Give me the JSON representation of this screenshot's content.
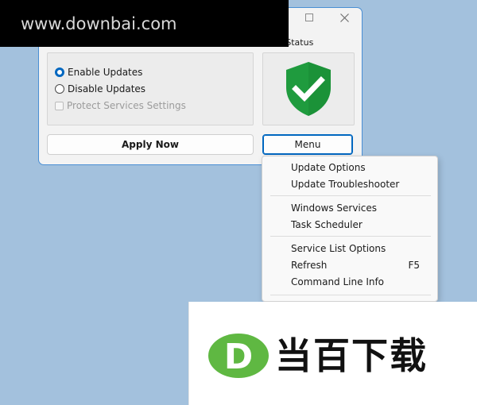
{
  "watermark_top": {
    "text": "www.downbai.com"
  },
  "window": {
    "status_label": "e Status",
    "options": {
      "enable": "Enable Updates",
      "disable": "Disable Updates",
      "protect": "Protect Services Settings"
    },
    "apply_label": "Apply Now",
    "menu_label": "Menu"
  },
  "context_menu": {
    "items": [
      {
        "label": "Update Options",
        "shortcut": ""
      },
      {
        "label": "Update Troubleshooter",
        "shortcut": ""
      },
      {
        "label": "Windows Services",
        "shortcut": ""
      },
      {
        "label": "Task Scheduler",
        "shortcut": ""
      },
      {
        "label": "Service List Options",
        "shortcut": ""
      },
      {
        "label": "Refresh",
        "shortcut": "F5"
      },
      {
        "label": "Command Line Info",
        "shortcut": ""
      }
    ]
  },
  "watermark_logo": {
    "letter": "D",
    "text": "当百下载"
  },
  "colors": {
    "accent": "#0067c0",
    "shield_green": "#1f9b3e",
    "logo_green": "#5fb842",
    "background": "#a3c1dd"
  },
  "icons": {
    "status": "shield-check-icon",
    "window_controls": [
      "maximize-icon",
      "close-icon"
    ]
  }
}
